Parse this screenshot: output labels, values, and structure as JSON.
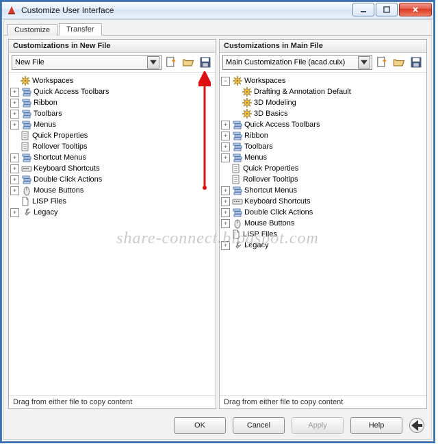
{
  "window": {
    "title": "Customize User Interface"
  },
  "tabs": [
    {
      "label": "Customize",
      "active": false
    },
    {
      "label": "Transfer",
      "active": true
    }
  ],
  "left_panel": {
    "header": "Customizations in New File",
    "dropdown": {
      "value": "New File"
    },
    "footer": "Drag from either file to copy content",
    "tree": [
      {
        "label": "Workspaces",
        "icon": "gear",
        "expandable": false
      },
      {
        "label": "Quick Access Toolbars",
        "icon": "stack",
        "expandable": true
      },
      {
        "label": "Ribbon",
        "icon": "stack",
        "expandable": true
      },
      {
        "label": "Toolbars",
        "icon": "stack",
        "expandable": true
      },
      {
        "label": "Menus",
        "icon": "stack",
        "expandable": true
      },
      {
        "label": "Quick Properties",
        "icon": "sheet",
        "expandable": false
      },
      {
        "label": "Rollover Tooltips",
        "icon": "sheet",
        "expandable": false
      },
      {
        "label": "Shortcut Menus",
        "icon": "stack",
        "expandable": true
      },
      {
        "label": "Keyboard Shortcuts",
        "icon": "keys",
        "expandable": true
      },
      {
        "label": "Double Click Actions",
        "icon": "stack",
        "expandable": true
      },
      {
        "label": "Mouse Buttons",
        "icon": "mouse",
        "expandable": true
      },
      {
        "label": "LISP Files",
        "icon": "file",
        "expandable": false
      },
      {
        "label": "Legacy",
        "icon": "wrench",
        "expandable": true
      }
    ]
  },
  "right_panel": {
    "header": "Customizations in Main File",
    "dropdown": {
      "value": "Main Customization File (acad.cuix)"
    },
    "footer": "Drag from either file to copy content",
    "tree": [
      {
        "label": "Workspaces",
        "icon": "gear",
        "expandable": true,
        "expanded": true,
        "children": [
          {
            "label": "Drafting & Annotation Default",
            "icon": "gear"
          },
          {
            "label": "3D Modeling",
            "icon": "gear"
          },
          {
            "label": "3D Basics",
            "icon": "gear"
          }
        ]
      },
      {
        "label": "Quick Access Toolbars",
        "icon": "stack",
        "expandable": true
      },
      {
        "label": "Ribbon",
        "icon": "stack",
        "expandable": true
      },
      {
        "label": "Toolbars",
        "icon": "stack",
        "expandable": true
      },
      {
        "label": "Menus",
        "icon": "stack",
        "expandable": true
      },
      {
        "label": "Quick Properties",
        "icon": "sheet",
        "expandable": false
      },
      {
        "label": "Rollover Tooltips",
        "icon": "sheet",
        "expandable": false
      },
      {
        "label": "Shortcut Menus",
        "icon": "stack",
        "expandable": true
      },
      {
        "label": "Keyboard Shortcuts",
        "icon": "keys",
        "expandable": true
      },
      {
        "label": "Double Click Actions",
        "icon": "stack",
        "expandable": true
      },
      {
        "label": "Mouse Buttons",
        "icon": "mouse",
        "expandable": true
      },
      {
        "label": "LISP Files",
        "icon": "file",
        "expandable": false
      },
      {
        "label": "Legacy",
        "icon": "wrench",
        "expandable": true
      }
    ]
  },
  "buttons": {
    "ok": "OK",
    "cancel": "Cancel",
    "apply": "Apply",
    "help": "Help"
  },
  "watermark": "share-connect.blogspot.com"
}
